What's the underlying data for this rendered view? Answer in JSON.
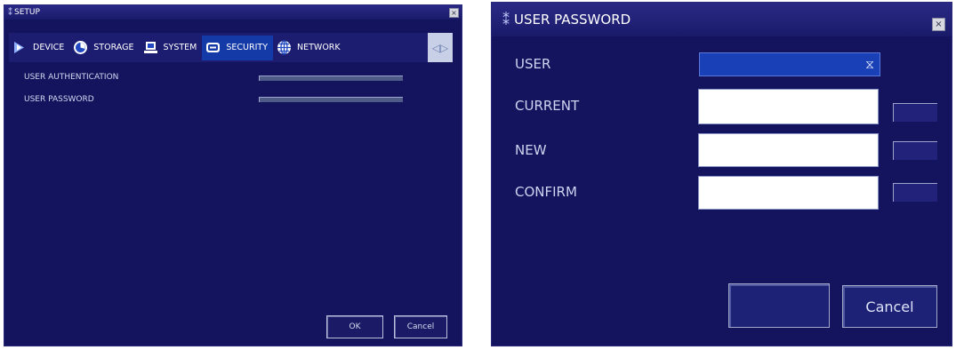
{
  "setup": {
    "title": "SETUP",
    "close_glyph": "×",
    "tabs": [
      {
        "label": "DEVICE",
        "icon": "device-icon"
      },
      {
        "label": "STORAGE",
        "icon": "storage-icon"
      },
      {
        "label": "SYSTEM",
        "icon": "system-icon"
      },
      {
        "label": "SECURITY",
        "icon": "security-icon",
        "active": true
      },
      {
        "label": "NETWORK",
        "icon": "network-icon"
      }
    ],
    "rows": [
      {
        "label": "USER AUTHENTICATION"
      },
      {
        "label": "USER PASSWORD"
      }
    ],
    "ok_label": "OK",
    "cancel_label": "Cancel"
  },
  "password_dialog": {
    "title": "USER PASSWORD",
    "close_glyph": "×",
    "user_label": "USER",
    "current_label": "CURRENT",
    "new_label": "NEW",
    "confirm_label": "CONFIRM",
    "cancel_label": "Cancel"
  },
  "colors": {
    "window_bg": "#14145e",
    "active_tab": "#143aa8",
    "select_bg": "#1a40b8"
  }
}
